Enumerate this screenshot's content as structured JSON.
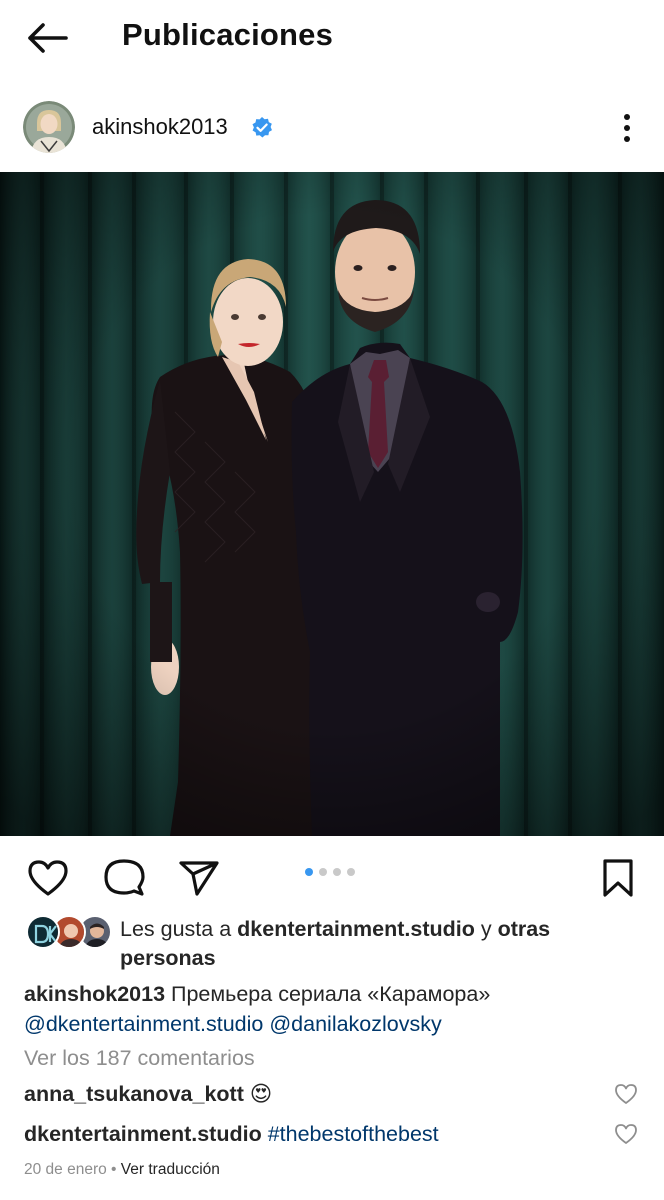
{
  "header": {
    "back_icon": "arrow-left-icon",
    "title": "Publicaciones"
  },
  "post": {
    "username": "akinshok2013",
    "verified": true,
    "verified_icon": "verified-badge-icon",
    "more_icon": "more-vertical-icon"
  },
  "actions": {
    "like_icon": "heart-outline-icon",
    "comment_icon": "comment-bubble-icon",
    "share_icon": "send-icon",
    "save_icon": "bookmark-outline-icon",
    "carousel": {
      "total": 4,
      "active_index": 0
    }
  },
  "likes": {
    "prefix": "Les gusta a ",
    "user": "dkentertainment.studio",
    "middle": " y ",
    "others": "otras personas"
  },
  "caption": {
    "username": "akinshok2013",
    "text": " Премьера сериала «Карамора»",
    "mention_1": "@dkentertainment.studio",
    "mention_2": "@danilakozlovsky"
  },
  "comments_link": "Ver los 187 comentarios",
  "comments": [
    {
      "username": "anna_tsukanova_kott",
      "text": " 😍"
    },
    {
      "username": "dkentertainment.studio",
      "text": " ",
      "hashtag": "#thebestofthebest"
    }
  ],
  "footer": {
    "date": "20 de enero",
    "separator": " • ",
    "translate": "Ver traducción"
  },
  "colors": {
    "verified_blue": "#3897f0",
    "link_blue": "#00376b",
    "muted_gray": "#8e8e8e",
    "curtain_green": "#143a35"
  }
}
